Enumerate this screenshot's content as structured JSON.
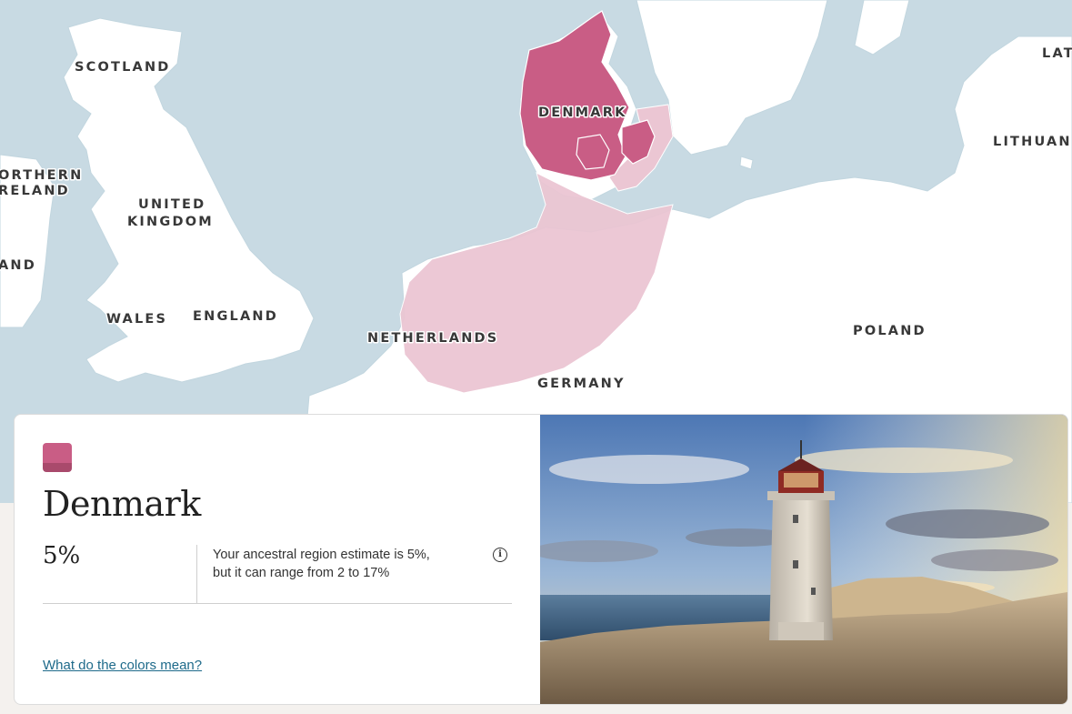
{
  "map": {
    "labels": {
      "scotland": "SCOTLAND",
      "northern_ireland_1": "ORTHERN",
      "northern_ireland_2": "RELAND",
      "ireland": "AND",
      "uk_1": "UNITED",
      "uk_2": "KINGDOM",
      "wales": "WALES",
      "england": "ENGLAND",
      "denmark": "DENMARK",
      "netherlands": "NETHERLANDS",
      "germany": "GERMANY",
      "poland": "POLAND",
      "lithuania": "LITHUAN",
      "latvia": "LAT"
    },
    "colors": {
      "sea": "#c8dae3",
      "land": "#ffffff",
      "core_region": "#c95d85",
      "extended_region": "#ebc6d3",
      "label": "#383838"
    }
  },
  "region": {
    "name": "Denmark",
    "percent": "5%",
    "estimate_line1": "Your ancestral region estimate is 5%,",
    "estimate_line2": "but it can range from 2 to 17%",
    "swatch_color": "#c95d85",
    "swatch_shade": "#a94a6c",
    "info_icon": "info-icon",
    "colors_link": "What do the colors mean?"
  },
  "photo": {
    "subject": "lighthouse-on-dunes"
  }
}
